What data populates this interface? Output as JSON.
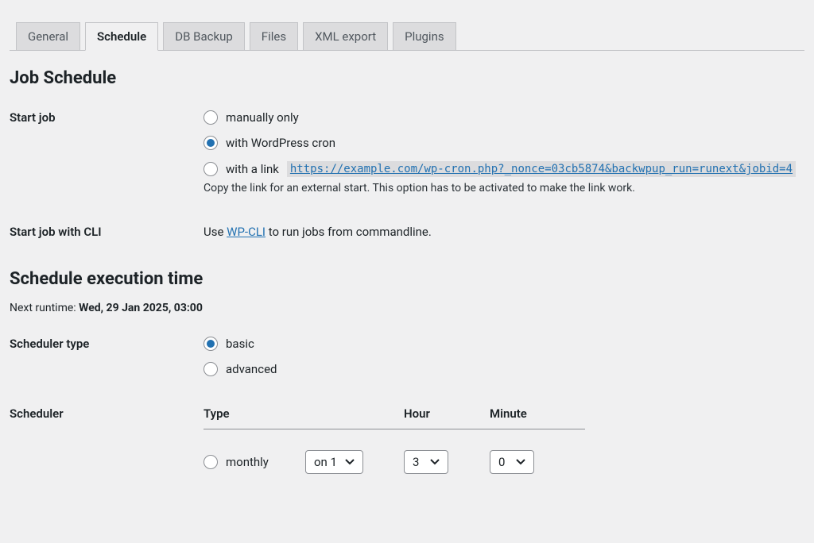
{
  "tabs": {
    "general": "General",
    "schedule": "Schedule",
    "db_backup": "DB Backup",
    "files": "Files",
    "xml_export": "XML export",
    "plugins": "Plugins"
  },
  "section_job_schedule": "Job Schedule",
  "start_job": {
    "label": "Start job",
    "opt_manually": "manually only",
    "opt_wpcron": "with WordPress cron",
    "opt_link_label": "with a link",
    "link_url": "https://example.com/wp-cron.php?_nonce=03cb5874&backwpup_run=runext&jobid=4",
    "link_hint": "Copy the link for an external start. This option has to be activated to make the link work."
  },
  "start_job_cli": {
    "label": "Start job with CLI",
    "prefix": "Use ",
    "link": "WP-CLI",
    "suffix": " to run jobs from commandline."
  },
  "section_exec": "Schedule execution time",
  "next_runtime_prefix": "Next runtime: ",
  "next_runtime_value": "Wed, 29 Jan 2025, 03:00",
  "scheduler_type": {
    "label": "Scheduler type",
    "opt_basic": "basic",
    "opt_advanced": "advanced"
  },
  "scheduler": {
    "label": "Scheduler",
    "col_type": "Type",
    "col_hour": "Hour",
    "col_minute": "Minute",
    "row_monthly": "monthly",
    "sel_day": "on 1",
    "sel_hour": "3",
    "sel_min": "0"
  }
}
